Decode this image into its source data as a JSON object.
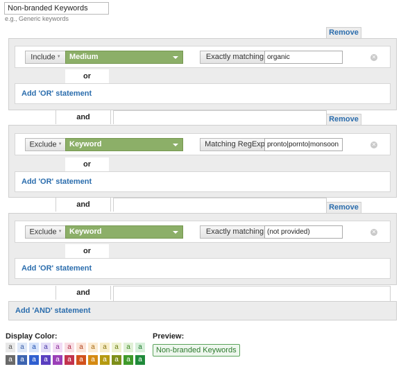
{
  "segment": {
    "name": "Non-branded Keywords",
    "hint": "e.g., Generic keywords"
  },
  "remove_label": "Remove",
  "or_label": "or",
  "and_label": "and",
  "add_or_label": "Add 'OR' statement",
  "add_and_label": "Add 'AND' statement",
  "conditions": [
    {
      "mode": "Include",
      "dimension": "Medium",
      "match_type": "Exactly matching",
      "value": "organic"
    },
    {
      "mode": "Exclude",
      "dimension": "Keyword",
      "match_type": "Matching RegExp",
      "value": "pronto|pornto|monsoon"
    },
    {
      "mode": "Exclude",
      "dimension": "Keyword",
      "match_type": "Exactly matching",
      "value": "(not provided)"
    }
  ],
  "display_color": {
    "label": "Display Color:",
    "swatch_letter": "a",
    "light_row": [
      {
        "bg": "#e8e8e8",
        "fg": "#555555"
      },
      {
        "bg": "#dde7f7",
        "fg": "#3a5ea8"
      },
      {
        "bg": "#d6e3fa",
        "fg": "#1f4fb0"
      },
      {
        "bg": "#e2dcf7",
        "fg": "#4a3aa8"
      },
      {
        "bg": "#f2dcf5",
        "fg": "#8a2f9a"
      },
      {
        "bg": "#f8dde3",
        "fg": "#b0304a"
      },
      {
        "bg": "#fbe3d7",
        "fg": "#b0451f"
      },
      {
        "bg": "#fbebd2",
        "fg": "#a86a10"
      },
      {
        "bg": "#f7edc8",
        "fg": "#8a7510"
      },
      {
        "bg": "#eef2cf",
        "fg": "#6b7d13"
      },
      {
        "bg": "#e0f0d6",
        "fg": "#3f8a22"
      },
      {
        "bg": "#d6efd9",
        "fg": "#1f7a2f"
      }
    ],
    "dark_row": [
      {
        "bg": "#6a6a6a",
        "fg": "#ffffff"
      },
      {
        "bg": "#3d64b0",
        "fg": "#ffffff"
      },
      {
        "bg": "#2f5fd0",
        "fg": "#ffffff"
      },
      {
        "bg": "#5a3fc0",
        "fg": "#ffffff"
      },
      {
        "bg": "#9b3fb8",
        "fg": "#ffffff"
      },
      {
        "bg": "#c2334e",
        "fg": "#ffffff"
      },
      {
        "bg": "#d2521c",
        "fg": "#ffffff"
      },
      {
        "bg": "#d58a12",
        "fg": "#ffffff"
      },
      {
        "bg": "#b59a10",
        "fg": "#ffffff"
      },
      {
        "bg": "#7e8f1a",
        "fg": "#ffffff"
      },
      {
        "bg": "#3f9a2a",
        "fg": "#ffffff"
      },
      {
        "bg": "#1f8a3a",
        "fg": "#ffffff"
      }
    ]
  },
  "preview": {
    "label": "Preview:",
    "text": "Non-branded Keywords"
  }
}
